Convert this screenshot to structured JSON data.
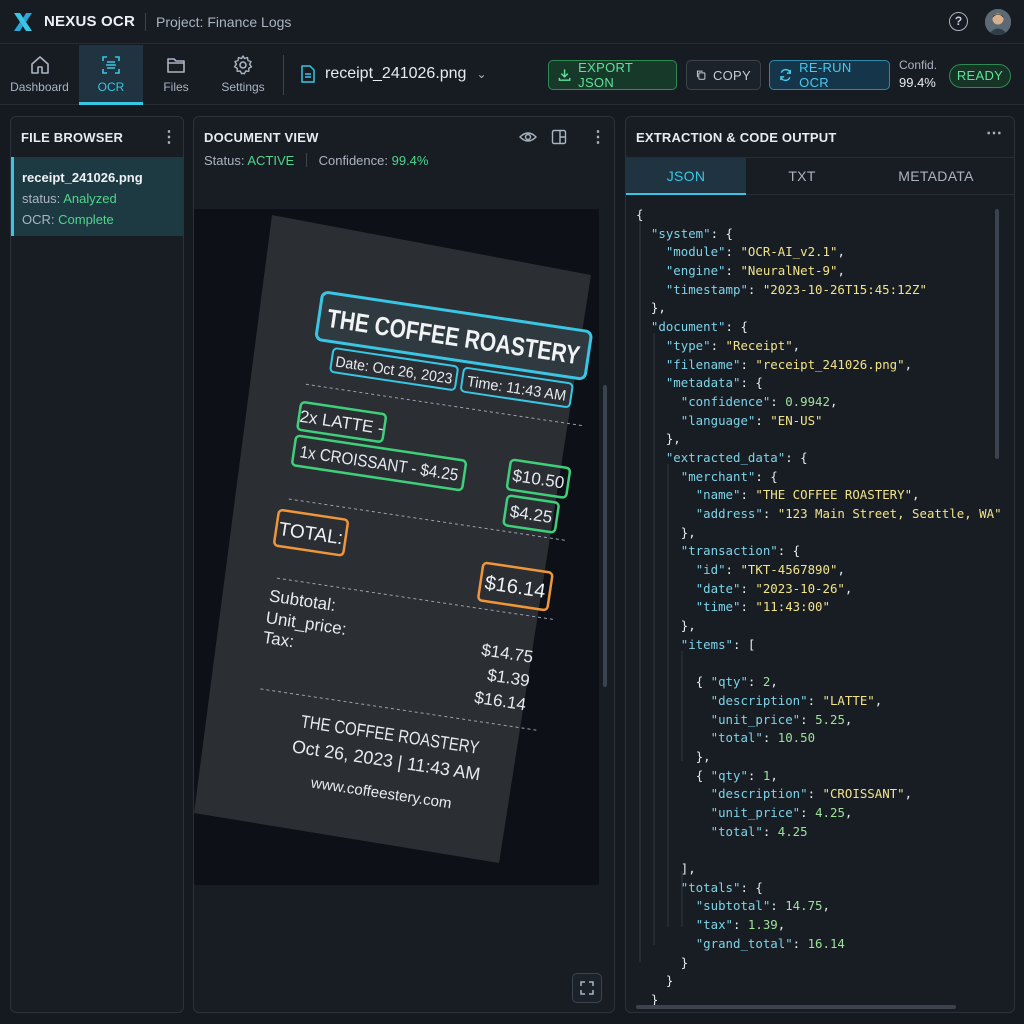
{
  "app": {
    "name": "NEXUS OCR",
    "project": "Project: Finance Logs"
  },
  "nav": [
    {
      "label": "Dashboard",
      "icon": "home-icon"
    },
    {
      "label": "OCR",
      "icon": "scan-icon"
    },
    {
      "label": "Files",
      "icon": "folder-icon"
    },
    {
      "label": "Settings",
      "icon": "gear-icon"
    }
  ],
  "toolbar": {
    "file": "receipt_241026.png",
    "export_label": "EXPORT JSON",
    "copy_label": "COPY",
    "rerun_label": "RE-RUN OCR",
    "confidence_label": "Confid.",
    "confidence_value": "99.4%",
    "status_pill": "READY"
  },
  "file_browser": {
    "title": "FILE BROWSER",
    "items": [
      {
        "name": "receipt_241026.png",
        "status_key": "status:",
        "status_value": "Analyzed",
        "ocr_key": "OCR:",
        "ocr_value": "Complete"
      }
    ]
  },
  "document_view": {
    "title": "DOCUMENT VIEW",
    "status_label": "Status:",
    "status_value": "ACTIVE",
    "confidence_label": "Confidence:",
    "confidence_value": "99.4%",
    "receipt": {
      "merchant": "THE COFFEE ROASTERY",
      "date": "Date: Oct 26, 2023",
      "time": "Time: 11:43 AM",
      "line1": "2x LATTE -",
      "line2": "1x CROISSANT - $4.25",
      "amount1": "$10.50",
      "amount2": "$4.25",
      "total_label": "TOTAL:",
      "total_value": "$16.14",
      "subtotal_label": "Subtotal:",
      "unit_price_label": "Unit_price:",
      "tax_label": "Tax:",
      "subtotal_value": "$14.75",
      "tax_value": "$1.39",
      "grand_value": "$16.14",
      "footer_name": "THE COFFEE ROASTERY",
      "footer_datetime": "Oct 26, 2023  |  11:43 AM",
      "footer_url": "www.coffeestery.com"
    },
    "colors": {
      "cyan": "#39c6e4",
      "green": "#3fcf7a",
      "orange": "#f0963a"
    }
  },
  "extraction": {
    "title": "EXTRACTION & CODE OUTPUT",
    "tabs": [
      "JSON",
      "TXT",
      "METADATA"
    ],
    "active_tab": "JSON",
    "json_lines": [
      [
        [
          "p",
          "{"
        ]
      ],
      [
        [
          "i",
          "  "
        ],
        [
          "k",
          "\"system\""
        ],
        [
          "p",
          ": {"
        ]
      ],
      [
        [
          "i",
          "    "
        ],
        [
          "k",
          "\"module\""
        ],
        [
          "p",
          ": "
        ],
        [
          "s",
          "\"OCR-AI_v2.1\""
        ],
        [
          "p",
          ","
        ]
      ],
      [
        [
          "i",
          "    "
        ],
        [
          "k",
          "\"engine\""
        ],
        [
          "p",
          ": "
        ],
        [
          "s",
          "\"NeuralNet-9\""
        ],
        [
          "p",
          ","
        ]
      ],
      [
        [
          "i",
          "    "
        ],
        [
          "k",
          "\"timestamp\""
        ],
        [
          "p",
          ": "
        ],
        [
          "s",
          "\"2023-10-26T15:45:12Z\""
        ]
      ],
      [
        [
          "i",
          "  "
        ],
        [
          "p",
          "},"
        ]
      ],
      [
        [
          "i",
          "  "
        ],
        [
          "k",
          "\"document\""
        ],
        [
          "p",
          ": {"
        ]
      ],
      [
        [
          "i",
          "    "
        ],
        [
          "k",
          "\"type\""
        ],
        [
          "p",
          ": "
        ],
        [
          "s",
          "\"Receipt\""
        ],
        [
          "p",
          ","
        ]
      ],
      [
        [
          "i",
          "    "
        ],
        [
          "k",
          "\"filename\""
        ],
        [
          "p",
          ": "
        ],
        [
          "s",
          "\"receipt_241026.png\""
        ],
        [
          "p",
          ","
        ]
      ],
      [
        [
          "i",
          "    "
        ],
        [
          "k",
          "\"metadata\""
        ],
        [
          "p",
          ": {"
        ]
      ],
      [
        [
          "i",
          "      "
        ],
        [
          "k",
          "\"confidence\""
        ],
        [
          "p",
          ": "
        ],
        [
          "n",
          "0.9942"
        ],
        [
          "p",
          ","
        ]
      ],
      [
        [
          "i",
          "      "
        ],
        [
          "k",
          "\"language\""
        ],
        [
          "p",
          ": "
        ],
        [
          "s",
          "\"EN-US\""
        ]
      ],
      [
        [
          "i",
          "    "
        ],
        [
          "p",
          "},"
        ]
      ],
      [
        [
          "i",
          "    "
        ],
        [
          "k",
          "\"extracted_data\""
        ],
        [
          "p",
          ": {"
        ]
      ],
      [
        [
          "i",
          "      "
        ],
        [
          "k",
          "\"merchant\""
        ],
        [
          "p",
          ": {"
        ]
      ],
      [
        [
          "i",
          "        "
        ],
        [
          "k",
          "\"name\""
        ],
        [
          "p",
          ": "
        ],
        [
          "s",
          "\"THE COFFEE ROASTERY\""
        ],
        [
          "p",
          ","
        ]
      ],
      [
        [
          "i",
          "        "
        ],
        [
          "k",
          "\"address\""
        ],
        [
          "p",
          ": "
        ],
        [
          "s",
          "\"123 Main Street, Seattle, WA\""
        ]
      ],
      [
        [
          "i",
          "      "
        ],
        [
          "p",
          "},"
        ]
      ],
      [
        [
          "i",
          "      "
        ],
        [
          "k",
          "\"transaction\""
        ],
        [
          "p",
          ": {"
        ]
      ],
      [
        [
          "i",
          "        "
        ],
        [
          "k",
          "\"id\""
        ],
        [
          "p",
          ": "
        ],
        [
          "s",
          "\"TKT-4567890\""
        ],
        [
          "p",
          ","
        ]
      ],
      [
        [
          "i",
          "        "
        ],
        [
          "k",
          "\"date\""
        ],
        [
          "p",
          ": "
        ],
        [
          "s",
          "\"2023-10-26\""
        ],
        [
          "p",
          ","
        ]
      ],
      [
        [
          "i",
          "        "
        ],
        [
          "k",
          "\"time\""
        ],
        [
          "p",
          ": "
        ],
        [
          "s",
          "\"11:43:00\""
        ]
      ],
      [
        [
          "i",
          "      "
        ],
        [
          "p",
          "},"
        ]
      ],
      [
        [
          "i",
          "      "
        ],
        [
          "k",
          "\"items\""
        ],
        [
          "p",
          ": ["
        ]
      ],
      [
        [
          "i",
          ""
        ]
      ],
      [
        [
          "i",
          "        "
        ],
        [
          "p",
          "{ "
        ],
        [
          "k",
          "\"qty\""
        ],
        [
          "p",
          ": "
        ],
        [
          "n",
          "2"
        ],
        [
          "p",
          ","
        ]
      ],
      [
        [
          "i",
          "          "
        ],
        [
          "k",
          "\"description\""
        ],
        [
          "p",
          ": "
        ],
        [
          "s",
          "\"LATTE\""
        ],
        [
          "p",
          ","
        ]
      ],
      [
        [
          "i",
          "          "
        ],
        [
          "k",
          "\"unit_price\""
        ],
        [
          "p",
          ": "
        ],
        [
          "n",
          "5.25"
        ],
        [
          "p",
          ","
        ]
      ],
      [
        [
          "i",
          "          "
        ],
        [
          "k",
          "\"total\""
        ],
        [
          "p",
          ": "
        ],
        [
          "n",
          "10.50"
        ]
      ],
      [
        [
          "i",
          "        "
        ],
        [
          "p",
          "},"
        ]
      ],
      [
        [
          "i",
          "        "
        ],
        [
          "p",
          "{ "
        ],
        [
          "k",
          "\"qty\""
        ],
        [
          "p",
          ": "
        ],
        [
          "n",
          "1"
        ],
        [
          "p",
          ","
        ]
      ],
      [
        [
          "i",
          "          "
        ],
        [
          "k",
          "\"description\""
        ],
        [
          "p",
          ": "
        ],
        [
          "s",
          "\"CROISSANT\""
        ],
        [
          "p",
          ","
        ]
      ],
      [
        [
          "i",
          "          "
        ],
        [
          "k",
          "\"unit_price\""
        ],
        [
          "p",
          ": "
        ],
        [
          "n",
          "4.25"
        ],
        [
          "p",
          ","
        ]
      ],
      [
        [
          "i",
          "          "
        ],
        [
          "k",
          "\"total\""
        ],
        [
          "p",
          ": "
        ],
        [
          "n",
          "4.25"
        ]
      ],
      [
        [
          "i",
          ""
        ]
      ],
      [
        [
          "i",
          "      "
        ],
        [
          "p",
          "],"
        ]
      ],
      [
        [
          "i",
          "      "
        ],
        [
          "k",
          "\"totals\""
        ],
        [
          "p",
          ": {"
        ]
      ],
      [
        [
          "i",
          "        "
        ],
        [
          "k",
          "\"subtotal\""
        ],
        [
          "p",
          ": "
        ],
        [
          "n",
          "14.75"
        ],
        [
          "p",
          ","
        ]
      ],
      [
        [
          "i",
          "        "
        ],
        [
          "k",
          "\"tax\""
        ],
        [
          "p",
          ": "
        ],
        [
          "n",
          "1.39"
        ],
        [
          "p",
          ","
        ]
      ],
      [
        [
          "i",
          "        "
        ],
        [
          "k",
          "\"grand_total\""
        ],
        [
          "p",
          ": "
        ],
        [
          "n",
          "16.14"
        ]
      ],
      [
        [
          "i",
          "      "
        ],
        [
          "p",
          "}"
        ]
      ],
      [
        [
          "i",
          "    "
        ],
        [
          "p",
          "}"
        ]
      ],
      [
        [
          "i",
          "  "
        ],
        [
          "p",
          "}"
        ]
      ]
    ]
  }
}
